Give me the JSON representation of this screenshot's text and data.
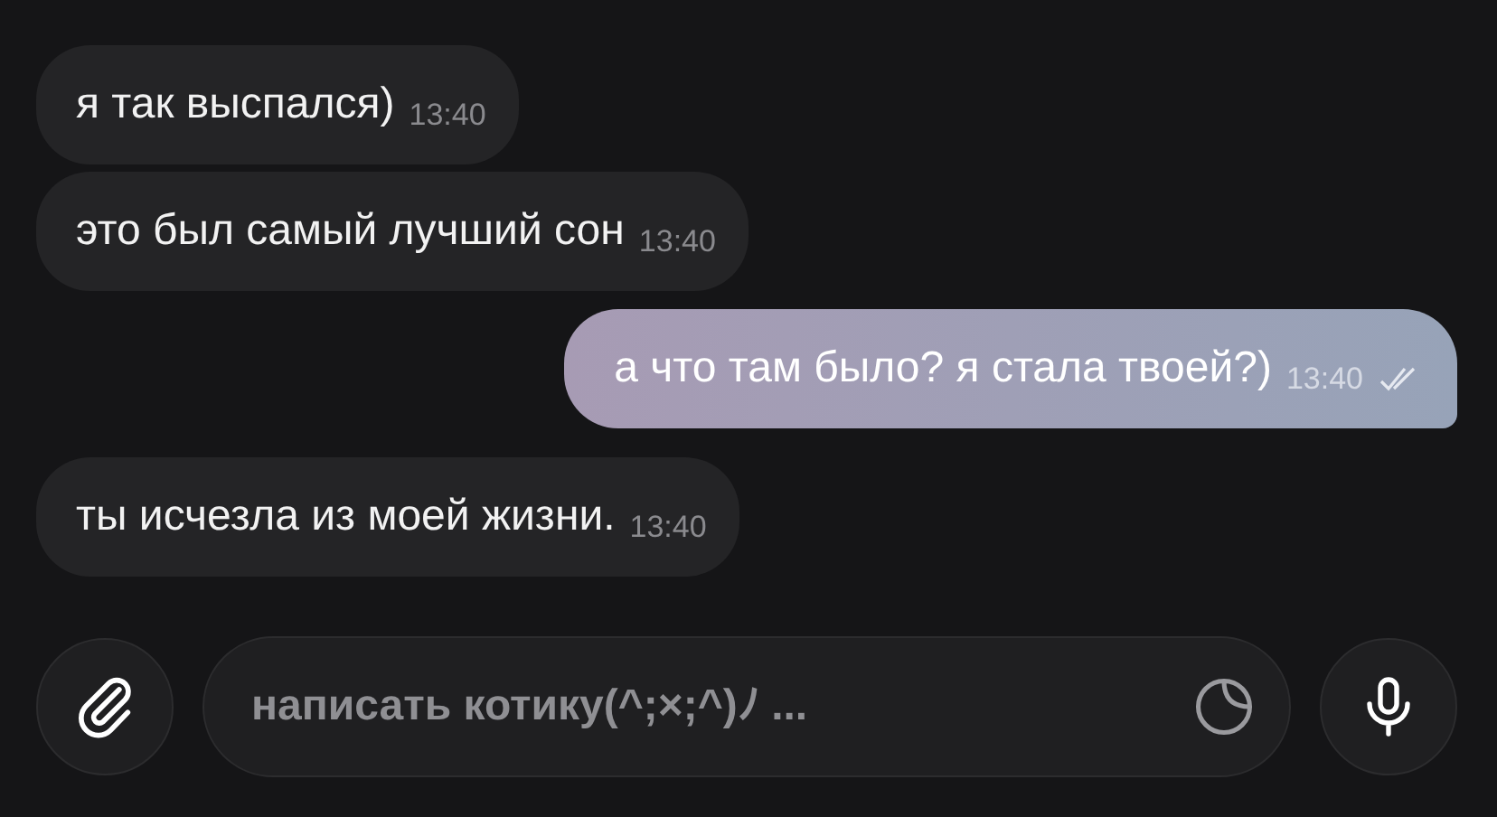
{
  "messages": [
    {
      "kind": "incoming",
      "text": "я так выспался)",
      "time": "13:40"
    },
    {
      "kind": "incoming",
      "text": "это был самый лучший сон",
      "time": "13:40"
    },
    {
      "kind": "outgoing",
      "text": "а что там было? я стала твоей?)",
      "time": "13:40",
      "read": true
    },
    {
      "kind": "incoming",
      "text": "ты исчезла из моей жизни.",
      "time": "13:40"
    }
  ],
  "composer": {
    "placeholder": "написать котику(^;×;^)ﾉ ..."
  }
}
